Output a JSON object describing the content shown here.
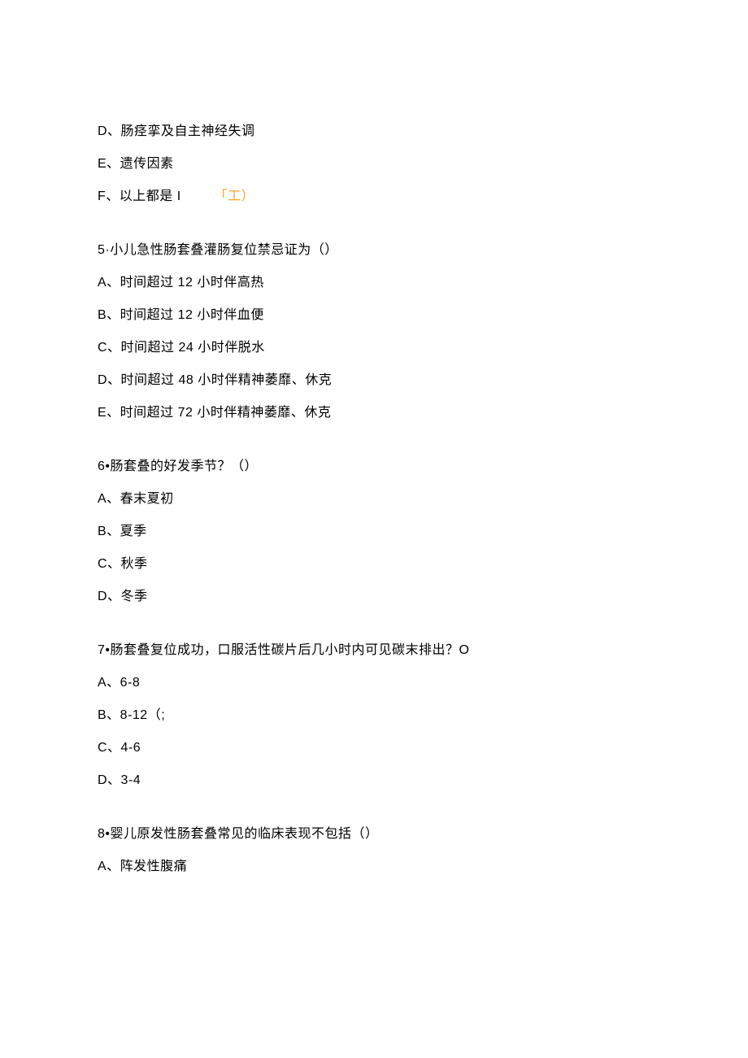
{
  "q4_tail": {
    "d": "D、肠痉挛及自主神经失调",
    "e": "E、遗传因素",
    "f_prefix": "F、以上都是 I",
    "f_annot": "「工）"
  },
  "q5": {
    "stem": "5·小儿急性肠套叠灌肠复位禁忌证为（）",
    "a": "A、时间超过 12 小时伴高热",
    "b": "B、时间超过 12 小时伴血便",
    "c": "C、时间超过 24 小时伴脱水",
    "d": "D、时间超过 48 小时伴精神萎靡、休克",
    "e": "E、时间超过 72 小时伴精神萎靡、休克"
  },
  "q6": {
    "stem": "6•肠套叠的好发季节？（）",
    "a": "A、春末夏初",
    "b": "B、夏季",
    "c": "C、秋季",
    "d": "D、冬季"
  },
  "q7": {
    "stem": "7•肠套叠复位成功，口服活性碳片后几小时内可见碳末排出？O",
    "a": "A、6-8",
    "b": "B、8-12（;",
    "c": "C、4-6",
    "d": "D、3-4"
  },
  "q8": {
    "stem": "8•婴儿原发性肠套叠常见的临床表现不包括（）",
    "a": "A、阵发性腹痛"
  }
}
